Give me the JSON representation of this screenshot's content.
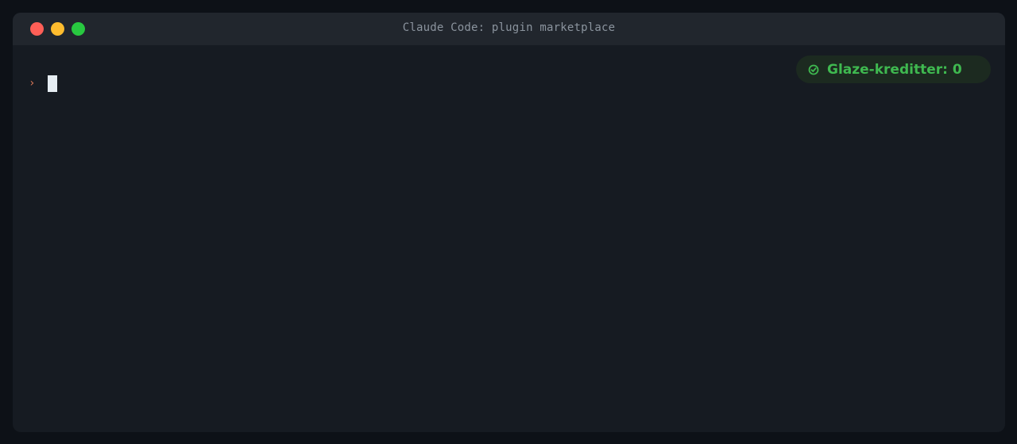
{
  "window": {
    "title": "Claude Code: plugin marketplace"
  },
  "terminal": {
    "prompt_symbol": "›",
    "input_value": ""
  },
  "badge": {
    "icon": "check-circle-icon",
    "text": "Glaze-kreditter: 0"
  },
  "colors": {
    "background": "#0d1117",
    "window": "#161b22",
    "titlebar": "#21262d",
    "prompt": "#d97757",
    "badge_text": "#3fb950",
    "badge_bg": "#1c2a20",
    "close": "#ff5f57",
    "minimize": "#febc2e",
    "maximize": "#28c840"
  }
}
